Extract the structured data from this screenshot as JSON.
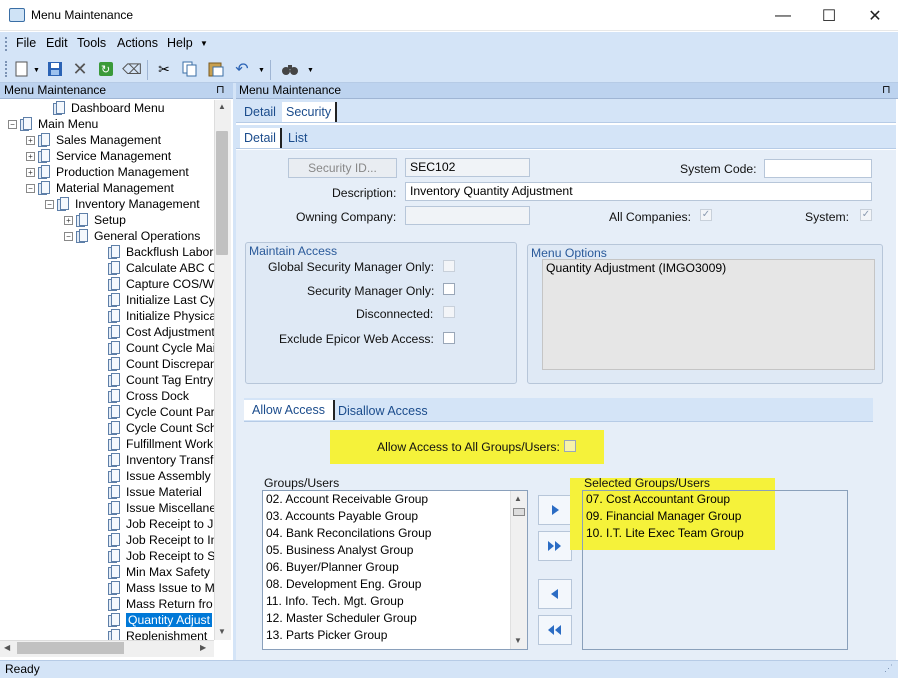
{
  "window": {
    "title": "Menu Maintenance",
    "minimize": "—",
    "maximize": "☐",
    "close": "✕"
  },
  "menubar": {
    "items": [
      "File",
      "Edit",
      "Tools",
      "Actions",
      "Help"
    ]
  },
  "left_panel": {
    "header": "Menu Maintenance",
    "pin": "⊓",
    "tree": [
      {
        "label": "Dashboard Menu",
        "level": 1,
        "expander": ""
      },
      {
        "label": "Main Menu",
        "level": 0,
        "expander": "−"
      },
      {
        "label": "Sales Management",
        "level": 1,
        "expander": "+"
      },
      {
        "label": "Service Management",
        "level": 1,
        "expander": "+"
      },
      {
        "label": "Production Management",
        "level": 1,
        "expander": "+"
      },
      {
        "label": "Material Management",
        "level": 1,
        "expander": "−"
      },
      {
        "label": "Inventory Management",
        "level": 2,
        "expander": "−"
      },
      {
        "label": "Setup",
        "level": 3,
        "expander": "+"
      },
      {
        "label": "General Operations",
        "level": 3,
        "expander": "−"
      },
      {
        "label": "Backflush Labor",
        "level": 4,
        "expander": ""
      },
      {
        "label": "Calculate ABC C",
        "level": 4,
        "expander": ""
      },
      {
        "label": "Capture COS/WI",
        "level": 4,
        "expander": ""
      },
      {
        "label": "Initialize Last Cy",
        "level": 4,
        "expander": ""
      },
      {
        "label": "Initialize Physica",
        "level": 4,
        "expander": ""
      },
      {
        "label": "Cost Adjustment",
        "level": 4,
        "expander": ""
      },
      {
        "label": "Count Cycle Mai",
        "level": 4,
        "expander": ""
      },
      {
        "label": "Count Discrepan",
        "level": 4,
        "expander": ""
      },
      {
        "label": "Count Tag Entry",
        "level": 4,
        "expander": ""
      },
      {
        "label": "Cross Dock",
        "level": 4,
        "expander": ""
      },
      {
        "label": "Cycle Count Par",
        "level": 4,
        "expander": ""
      },
      {
        "label": "Cycle Count Sch",
        "level": 4,
        "expander": ""
      },
      {
        "label": "Fulfillment Work",
        "level": 4,
        "expander": ""
      },
      {
        "label": "Inventory Transf",
        "level": 4,
        "expander": ""
      },
      {
        "label": "Issue Assembly",
        "level": 4,
        "expander": ""
      },
      {
        "label": "Issue Material",
        "level": 4,
        "expander": ""
      },
      {
        "label": "Issue Miscellane",
        "level": 4,
        "expander": ""
      },
      {
        "label": "Job Receipt to J",
        "level": 4,
        "expander": ""
      },
      {
        "label": "Job Receipt to In",
        "level": 4,
        "expander": ""
      },
      {
        "label": "Job Receipt to S",
        "level": 4,
        "expander": ""
      },
      {
        "label": "Min Max Safety",
        "level": 4,
        "expander": ""
      },
      {
        "label": "Mass Issue to Mf",
        "level": 4,
        "expander": ""
      },
      {
        "label": "Mass Return fro",
        "level": 4,
        "expander": ""
      },
      {
        "label": "Quantity Adjust",
        "level": 4,
        "expander": "",
        "selected": true
      },
      {
        "label": "Replenishment",
        "level": 4,
        "expander": ""
      }
    ]
  },
  "right_panel": {
    "header": "Menu Maintenance",
    "pin": "⊓",
    "top_tabs": [
      "Detail",
      "Security"
    ],
    "sub_tabs": [
      "Detail",
      "List"
    ],
    "security_id_button": "Security ID...",
    "security_id_value": "SEC102",
    "system_code_label": "System Code:",
    "system_code_value": "",
    "description_label": "Description:",
    "description_value": "Inventory Quantity Adjustment",
    "owning_company_label": "Owning Company:",
    "owning_company_value": "",
    "all_companies_label": "All Companies:",
    "system_label": "System:",
    "maintain_access": {
      "title": "Maintain Access",
      "global_security_manager": "Global Security Manager Only:",
      "security_manager": "Security Manager Only:",
      "disconnected": "Disconnected:",
      "exclude_web": "Exclude Epicor Web Access:"
    },
    "menu_options": {
      "title": "Menu Options",
      "value": "Quantity Adjustment (IMGO3009)"
    },
    "access_tabs": [
      "Allow Access",
      "Disallow Access"
    ],
    "allow_all_label": "Allow Access to All Groups/Users:",
    "groups_label": "Groups/Users",
    "groups": [
      "02. Account Receivable Group",
      "03. Accounts Payable Group",
      "04. Bank Reconcilations Group",
      "05. Business Analyst Group",
      "06. Buyer/Planner Group",
      "08. Development Eng. Group",
      "11. Info. Tech.  Mgt. Group",
      "12. Master Scheduler Group",
      "13. Parts Picker Group"
    ],
    "selected_label": "Selected Groups/Users",
    "selected_groups": [
      "07. Cost Accountant Group",
      "09. Financial Manager Group",
      "10. I.T. Lite Exec Team Group"
    ]
  },
  "colors": {
    "highlight": "#f5f23a",
    "selection": "#0078d7",
    "accent": "#1b4c8c"
  },
  "status": {
    "text": "Ready"
  }
}
